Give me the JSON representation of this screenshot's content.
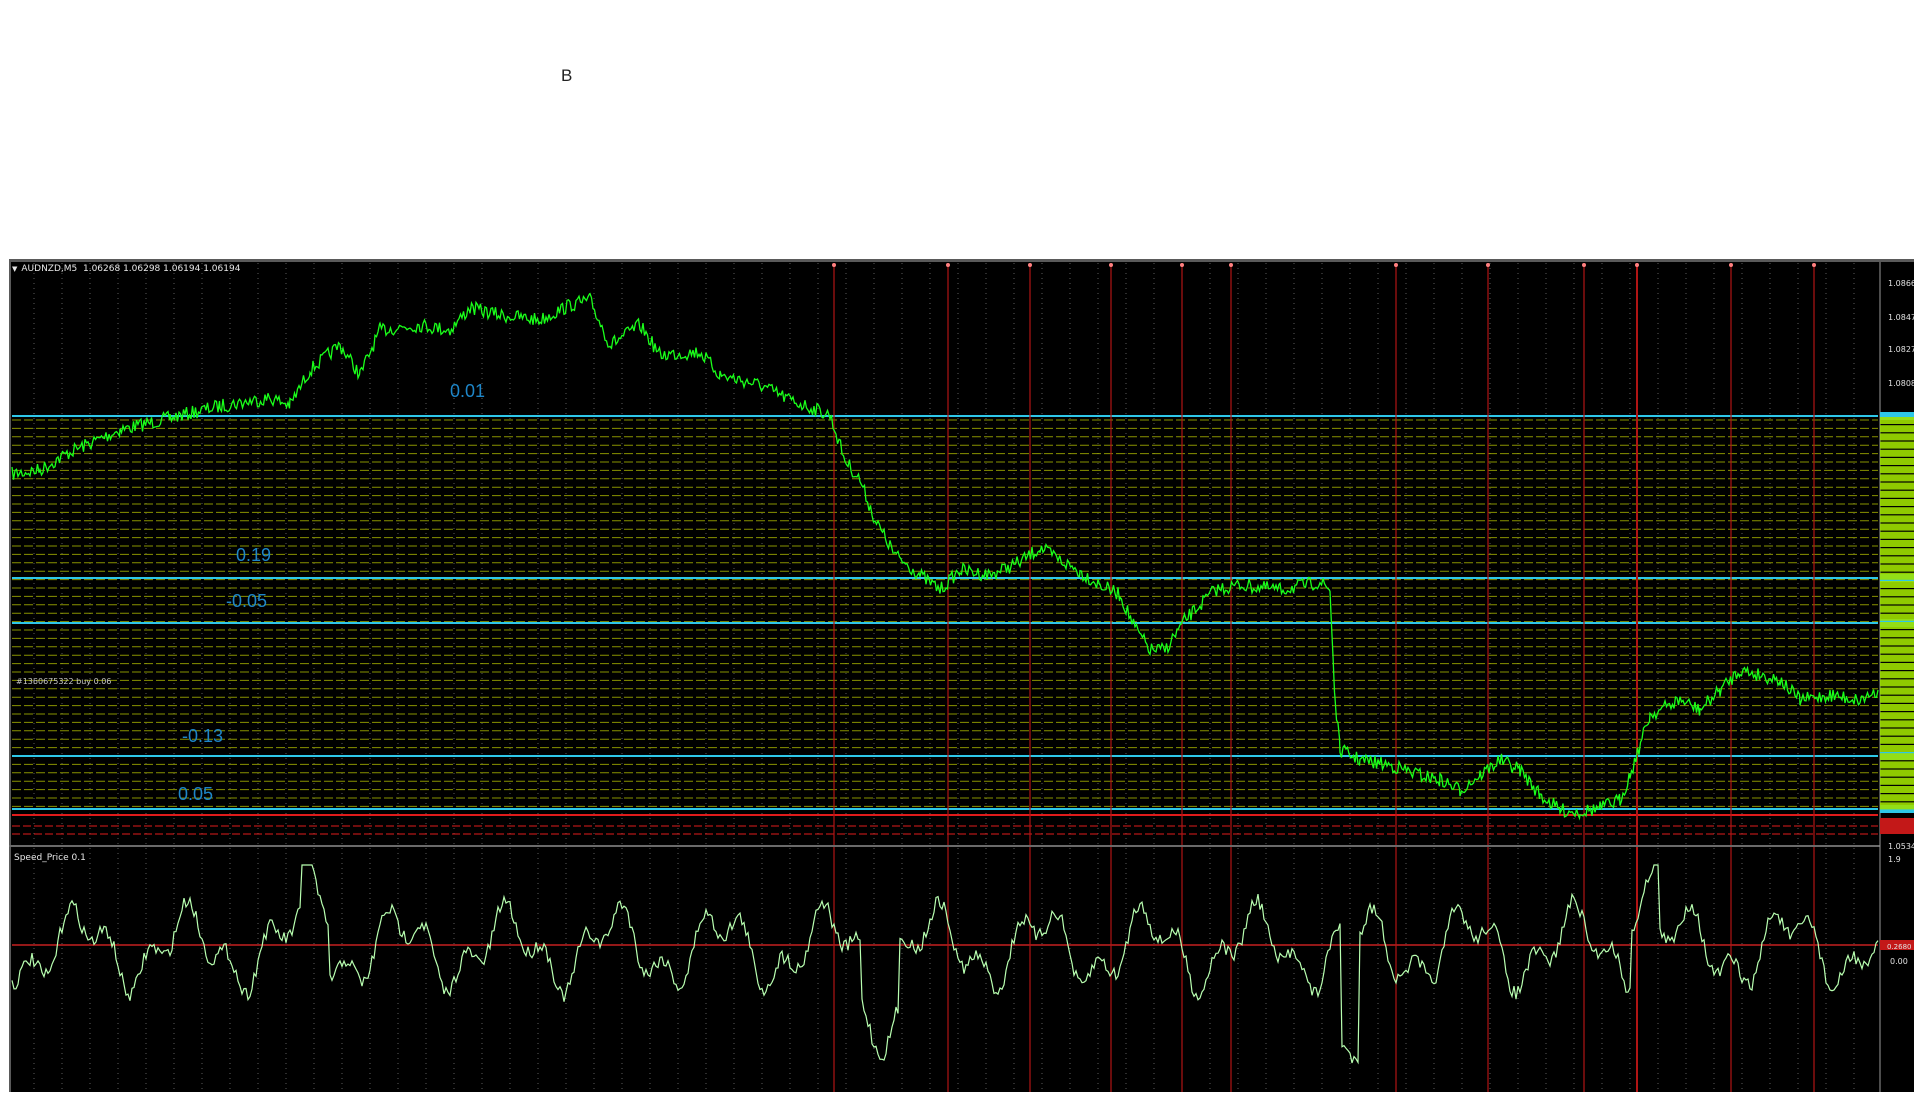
{
  "page": {
    "label": "B"
  },
  "main_chart": {
    "title": "AUDNZD,M5",
    "ohlc": "1.06268 1.06298 1.06194 1.06194",
    "order_label": "#1360675322 buy 0.06",
    "price_axis": [
      "1.0866",
      "1.0847",
      "1.0827",
      "1.0808",
      "1.0534"
    ],
    "level_labels": [
      "0.01",
      "0.19",
      "-0.05",
      "-0.13",
      "0.05"
    ]
  },
  "indicator": {
    "title": "Speed_Price 0.1",
    "axis": [
      "1.9",
      "0.00"
    ],
    "current_badge": "0.2680"
  },
  "colors": {
    "price_line": "#1aff1a",
    "indicator_line": "#b8ffb0",
    "level_line": "#2ec7e8",
    "label_blue": "#1e86c8",
    "grid_dash": "#b7c400",
    "vertical_marker": "#b01515",
    "stop_line": "#e01b1b",
    "axis_badge_green": "#9ee000"
  }
}
